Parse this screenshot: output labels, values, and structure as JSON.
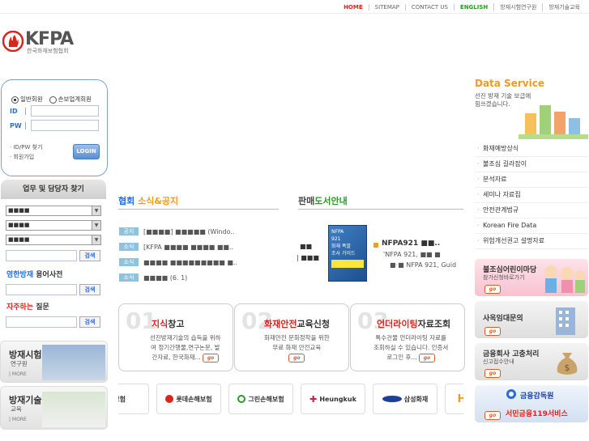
{
  "topnav": {
    "home": "HOME",
    "sitemap": "SITEMAP",
    "contact": "CONTACT US",
    "english": "ENGLISH",
    "research": "방재시험연구원",
    "education": "방재기술교육"
  },
  "logo": {
    "name": "KFPA",
    "sub": "한국화재보험협회"
  },
  "login": {
    "member_general": "일반회원",
    "member_insurer": "손보업계회원",
    "id_label": "ID",
    "pw_label": "PW",
    "find_link": "· ID/PW 찾기",
    "join_link": "· 회원가입",
    "login_button": "LOGIN"
  },
  "contact_search": {
    "title": "업무 및 담당자 찾기",
    "select1": "■■■■",
    "select2": "■■■■",
    "select3": "■■■■",
    "search_button": "검색"
  },
  "glossary": {
    "title_blue": "영한방재",
    "title_rest": " 용어사전",
    "search_button": "검색"
  },
  "faq": {
    "title_red": "자주하는",
    "title_rest": " 질문",
    "search_button": "검색"
  },
  "left_banners": [
    {
      "title": "방재시험",
      "sub": "연구원",
      "more": "| MORE"
    },
    {
      "title": "방재기술",
      "sub": "교육",
      "more": "| MORE"
    }
  ],
  "news": {
    "title_a": "협회",
    "title_b": " 소식&공지",
    "items": [
      {
        "tag": "공지",
        "text": "[■■■■] ■■■■■ (Windo.."
      },
      {
        "tag": "소식",
        "text": "[KFPA ■■■■ ■■■■ ■■.."
      },
      {
        "tag": "소식",
        "text": "■■■■ ■■■■■■■■■ ■.."
      },
      {
        "tag": "소식",
        "text": "■■■■ (6. 1)"
      }
    ]
  },
  "books": {
    "title_a": "판매",
    "title_b": "도서안내",
    "left_line1": "■■",
    "left_line2": "| ■■■",
    "cover_line1": "NFPA",
    "cover_line2": "921",
    "cover_line3": "화재 폭발",
    "cover_line4": "조사 가이드",
    "name": "NFPA921 ■■..",
    "desc1": "'NFPA 921, ■■ ■",
    "desc2": "■·■  NFPA 921, Guid"
  },
  "panels": [
    {
      "num": "01",
      "title_red": "지식",
      "title_rest": "창고",
      "desc1": "선진방재기술의 습득을 위하",
      "desc2": "여 정기간행물,연구논문, 발",
      "desc3": "간자료, 한국화재...",
      "go": "go"
    },
    {
      "num": "02",
      "title_red": "화재안전",
      "title_rest": "교육신청",
      "desc1": "화재안전 문화정착을 위한",
      "desc2": "무료 화재 안전교육",
      "desc3": "",
      "go": "go"
    },
    {
      "num": "03",
      "title_red": "언더라이팅",
      "title_rest": "자료조회",
      "desc1": "특수건물 언더라이팅 자료를",
      "desc2": "조회하실 수 있습니다. 인증서",
      "desc3": "로그인 후...",
      "go": "go"
    }
  ],
  "partners": [
    "해보험",
    "롯데손해보험",
    "그린손해보험",
    "Heungkuk",
    "삼성화재",
    "H"
  ],
  "data_service": {
    "title": "Data Service",
    "sub1": "선진 방재 기술 보급에",
    "sub2": "힘쓰겠습니다.",
    "items": [
      "화재예방상식",
      "불조심 길라잡이",
      "분석자료",
      "세미나 자료집",
      "안전관계법규",
      "Korean Fire Data",
      "위험개선권고 설명자료"
    ]
  },
  "right_banners": [
    {
      "title": "불조심어린이마당",
      "sub": "참가신청바로가기",
      "go": "go"
    },
    {
      "title": "사옥임대문의",
      "sub": "",
      "go": "go"
    },
    {
      "title": "금융회사 고충처리",
      "sub": "신고접수안내",
      "go": "go"
    },
    {
      "title": "금융감독원",
      "sub": "서민금융119서비스",
      "go": "go"
    }
  ],
  "colors": {
    "accent_red": "#d8261c",
    "accent_blue": "#2a6ed4",
    "accent_orange": "#f29b1f",
    "tag_blue": "#8ec2de"
  }
}
